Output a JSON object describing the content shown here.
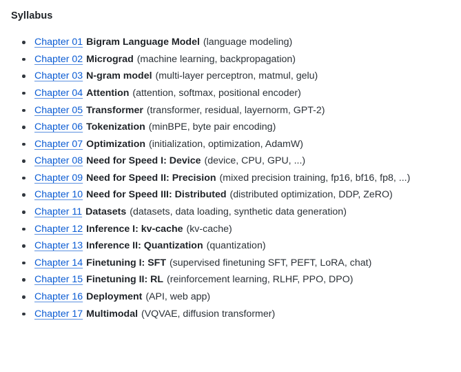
{
  "page": {
    "heading": "Syllabus",
    "link_color": "#0a5bd3",
    "text_color": "#24292f",
    "bold_color": "#1f2328",
    "background": "#ffffff",
    "bullet_color": "#32383f"
  },
  "syllabus": {
    "items": [
      {
        "link": "Chapter 01",
        "title": "Bigram Language Model",
        "topics": "(language modeling)"
      },
      {
        "link": "Chapter 02",
        "title": "Micrograd",
        "topics": "(machine learning, backpropagation)"
      },
      {
        "link": "Chapter 03",
        "title": "N-gram model",
        "topics": "(multi-layer perceptron, matmul, gelu)"
      },
      {
        "link": "Chapter 04",
        "title": "Attention",
        "topics": "(attention, softmax, positional encoder)"
      },
      {
        "link": "Chapter 05",
        "title": "Transformer",
        "topics": "(transformer, residual, layernorm, GPT-2)"
      },
      {
        "link": "Chapter 06",
        "title": "Tokenization",
        "topics": "(minBPE, byte pair encoding)"
      },
      {
        "link": "Chapter 07",
        "title": "Optimization",
        "topics": "(initialization, optimization, AdamW)"
      },
      {
        "link": "Chapter 08",
        "title": "Need for Speed I: Device",
        "topics": "(device, CPU, GPU, ...)"
      },
      {
        "link": "Chapter 09",
        "title": "Need for Speed II: Precision",
        "topics": "(mixed precision training, fp16, bf16, fp8, ...)"
      },
      {
        "link": "Chapter 10",
        "title": "Need for Speed III: Distributed",
        "topics": "(distributed optimization, DDP, ZeRO)"
      },
      {
        "link": "Chapter 11",
        "title": "Datasets",
        "topics": "(datasets, data loading, synthetic data generation)"
      },
      {
        "link": "Chapter 12",
        "title": "Inference I: kv-cache",
        "topics": "(kv-cache)"
      },
      {
        "link": "Chapter 13",
        "title": "Inference II: Quantization",
        "topics": "(quantization)"
      },
      {
        "link": "Chapter 14",
        "title": "Finetuning I: SFT",
        "topics": "(supervised finetuning SFT, PEFT, LoRA, chat)"
      },
      {
        "link": "Chapter 15",
        "title": "Finetuning II: RL",
        "topics": "(reinforcement learning, RLHF, PPO, DPO)"
      },
      {
        "link": "Chapter 16",
        "title": "Deployment",
        "topics": "(API, web app)"
      },
      {
        "link": "Chapter 17",
        "title": "Multimodal",
        "topics": "(VQVAE, diffusion transformer)"
      }
    ]
  }
}
